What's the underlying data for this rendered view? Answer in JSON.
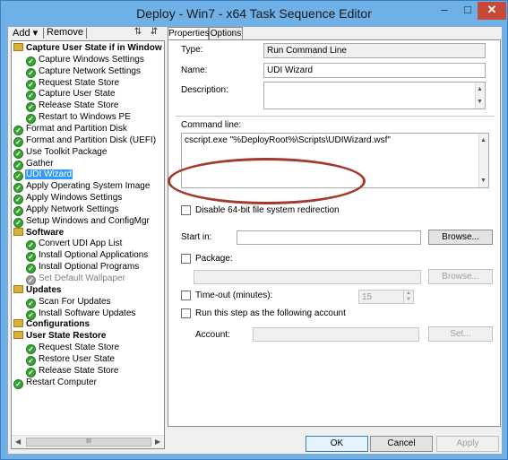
{
  "window": {
    "title": "Deploy - Win7 - x64 Task Sequence Editor",
    "controls": {
      "minimize": "–",
      "maximize": "□",
      "close": "✕"
    }
  },
  "toolbar": {
    "add_label": "Add",
    "add_arrow": "▾",
    "remove_label": "Remove",
    "icon1": "⇅",
    "icon2": "⇵"
  },
  "tree": [
    {
      "label": "Capture User State if in Window",
      "kind": "group",
      "indent": 0
    },
    {
      "label": "Capture Windows Settings",
      "kind": "check",
      "indent": 1
    },
    {
      "label": "Capture Network Settings",
      "kind": "check",
      "indent": 1
    },
    {
      "label": "Request State Store",
      "kind": "check",
      "indent": 1
    },
    {
      "label": "Capture User State",
      "kind": "check",
      "indent": 1
    },
    {
      "label": "Release State Store",
      "kind": "check",
      "indent": 1
    },
    {
      "label": "Restart to Windows PE",
      "kind": "check",
      "indent": 1
    },
    {
      "label": "Format and Partition Disk",
      "kind": "check",
      "indent": 0
    },
    {
      "label": "Format and Partition Disk (UEFI)",
      "kind": "check",
      "indent": 0
    },
    {
      "label": "Use Toolkit Package",
      "kind": "check",
      "indent": 0
    },
    {
      "label": "Gather",
      "kind": "check",
      "indent": 0
    },
    {
      "label": "UDI Wizard",
      "kind": "check",
      "indent": 0,
      "selected": true
    },
    {
      "label": "Apply Operating System Image",
      "kind": "check",
      "indent": 0
    },
    {
      "label": "Apply Windows Settings",
      "kind": "check",
      "indent": 0
    },
    {
      "label": "Apply Network Settings",
      "kind": "check",
      "indent": 0
    },
    {
      "label": "Setup Windows and ConfigMgr",
      "kind": "check",
      "indent": 0
    },
    {
      "label": "Software",
      "kind": "group",
      "indent": 0
    },
    {
      "label": "Convert UDI App List",
      "kind": "check",
      "indent": 1
    },
    {
      "label": "Install Optional Applications",
      "kind": "check",
      "indent": 1
    },
    {
      "label": "Install Optional Programs",
      "kind": "check",
      "indent": 1
    },
    {
      "label": "Set Default Wallpaper",
      "kind": "check-disabled",
      "indent": 1
    },
    {
      "label": "Updates",
      "kind": "group",
      "indent": 0
    },
    {
      "label": "Scan For Updates",
      "kind": "check",
      "indent": 1
    },
    {
      "label": "Install Software Updates",
      "kind": "check",
      "indent": 1
    },
    {
      "label": "Configurations",
      "kind": "group",
      "indent": 0
    },
    {
      "label": "User State Restore",
      "kind": "group",
      "indent": 0
    },
    {
      "label": "Request State Store",
      "kind": "check",
      "indent": 1
    },
    {
      "label": "Restore User State",
      "kind": "check",
      "indent": 1
    },
    {
      "label": "Release State Store",
      "kind": "check",
      "indent": 1
    },
    {
      "label": "Restart Computer",
      "kind": "check",
      "indent": 0
    }
  ],
  "tree_scroll": {
    "left": "◀",
    "right": "▶",
    "thumb": "III"
  },
  "tabs": {
    "properties": "Properties",
    "options": "Options"
  },
  "properties": {
    "type_label": "Type:",
    "type_value": "Run Command Line",
    "name_label": "Name:",
    "name_value": "UDI Wizard",
    "description_label": "Description:",
    "description_value": "",
    "command_line_label": "Command line:",
    "command_line_value": "cscript.exe \"%DeployRoot%\\Scripts\\UDIWizard.wsf\"",
    "disable_redirection_label": "Disable 64-bit file system redirection",
    "start_in_label": "Start in:",
    "start_in_value": "",
    "browse_label": "Browse...",
    "package_label": "Package:",
    "package_value": "",
    "package_browse_label": "Browse...",
    "timeout_label": "Time-out (minutes):",
    "timeout_value": "15",
    "run_as_label": "Run this step as the following account",
    "account_label": "Account:",
    "account_value": "",
    "set_label": "Set..."
  },
  "footer": {
    "ok": "OK",
    "cancel": "Cancel",
    "apply": "Apply"
  },
  "colors": {
    "titlebar": "#6fb0e6",
    "selection": "#3399ff",
    "annotation": "#a33a2e"
  }
}
